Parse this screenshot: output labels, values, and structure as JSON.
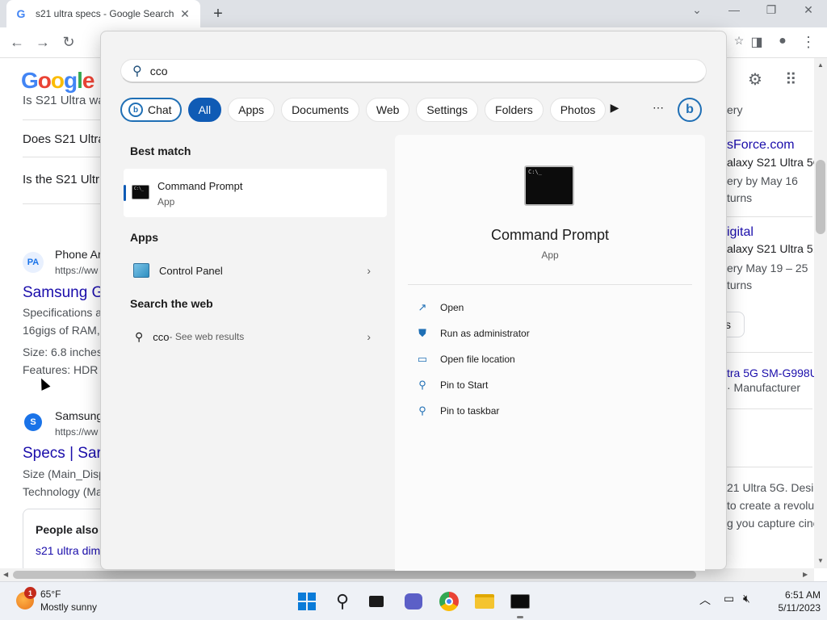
{
  "browser": {
    "tab_title": "s21 ultra specs - Google Search",
    "tab_favicon": "G"
  },
  "page": {
    "logo_letters": [
      "G",
      "o",
      "o",
      "g",
      "l",
      "e"
    ],
    "snippet_top": "Is S21 Ultra wa",
    "question1": "Does S21 Ultra",
    "question2": "Is the S21 Ultr",
    "result1_site": "Phone Ar",
    "result1_url": "https://ww",
    "result1_favicon": "PA",
    "result1_title": "Samsung G",
    "result1_snip1": "Specifications a",
    "result1_snip2": "16gigs of RAM,",
    "result1_size": "Size: 6.8 inches",
    "result1_features": "Features: HDR s",
    "result2_site": "Samsung",
    "result2_url": "https://ww",
    "result2_favicon": "S",
    "result2_title": "Specs | Sar",
    "result2_snip1": "Size (Main_Disp",
    "result2_snip2": "Technology (Ma",
    "people_also": "People also s",
    "people_link": "s21 ultra dim",
    "right": {
      "r1": "ery",
      "r2": "sForce.com",
      "r3": "alaxy S21 Ultra 5G",
      "r4": "ery by May 16",
      "r5": "turns",
      "r6": "igital",
      "r7": "alaxy S21 Ultra 5...",
      "r8": "ery May 19 – 25",
      "r9": "turns",
      "r10": "s",
      "r11": "tra 5G SM-G998U",
      "r12": "· Manufacturer",
      "r13": "21 Ultra 5G. Desig",
      "r14": "to create a revolut",
      "r15": "g you capture cine"
    }
  },
  "search": {
    "query": "cco",
    "filters": {
      "chat": "Chat",
      "all": "All",
      "apps": "Apps",
      "documents": "Documents",
      "web": "Web",
      "settings": "Settings",
      "folders": "Folders",
      "photos": "Photos"
    },
    "best_match_title": "Best match",
    "best_match_name": "Command Prompt",
    "best_match_type": "App",
    "apps_title": "Apps",
    "app1": "Control Panel",
    "web_title": "Search the web",
    "web_query": "cco",
    "web_suffix": " - See web results",
    "preview_name": "Command Prompt",
    "preview_type": "App",
    "actions": [
      "Open",
      "Run as administrator",
      "Open file location",
      "Pin to Start",
      "Pin to taskbar"
    ]
  },
  "taskbar": {
    "badge": "1",
    "temperature": "65°F",
    "condition": "Mostly sunny",
    "time": "6:51 AM",
    "date": "5/11/2023"
  },
  "colors": {
    "accent": "#0f5bb5",
    "link": "#1a0dab"
  }
}
